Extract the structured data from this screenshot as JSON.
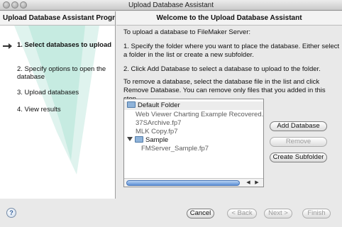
{
  "window": {
    "title": "Upload Database Assistant"
  },
  "left": {
    "heading": "Upload Database Assistant Progress",
    "steps": [
      {
        "label": "1. Select databases to upload"
      },
      {
        "label": "2. Specify options to open the database"
      },
      {
        "label": "3. Upload databases"
      },
      {
        "label": "4. View results"
      }
    ]
  },
  "main": {
    "heading": "Welcome to the Upload Database Assistant",
    "intro": "To upload a database to FileMaker Server:",
    "step1": "1.  Specify the folder where you want to place the database. Either select a folder in the list or create a new subfolder.",
    "step2": "2.  Click Add Database to select a database to upload to the folder.",
    "remove_note": "To remove a database, select the database file in the list and click Remove Database. You can remove only files that you added in this step.",
    "list": {
      "default_folder": "Default Folder",
      "items": [
        "Web Viewer Charting Example Recovered.fp7",
        "37SArchive.fp7",
        "MLK Copy.fp7"
      ],
      "sample_folder": "Sample",
      "sample_items": [
        "FMServer_Sample.fp7"
      ]
    },
    "buttons": {
      "add": "Add Database",
      "remove": "Remove",
      "create": "Create Subfolder"
    }
  },
  "footer": {
    "help": "?",
    "cancel": "Cancel",
    "back": "< Back",
    "next": "Next >",
    "finish": "Finish"
  }
}
